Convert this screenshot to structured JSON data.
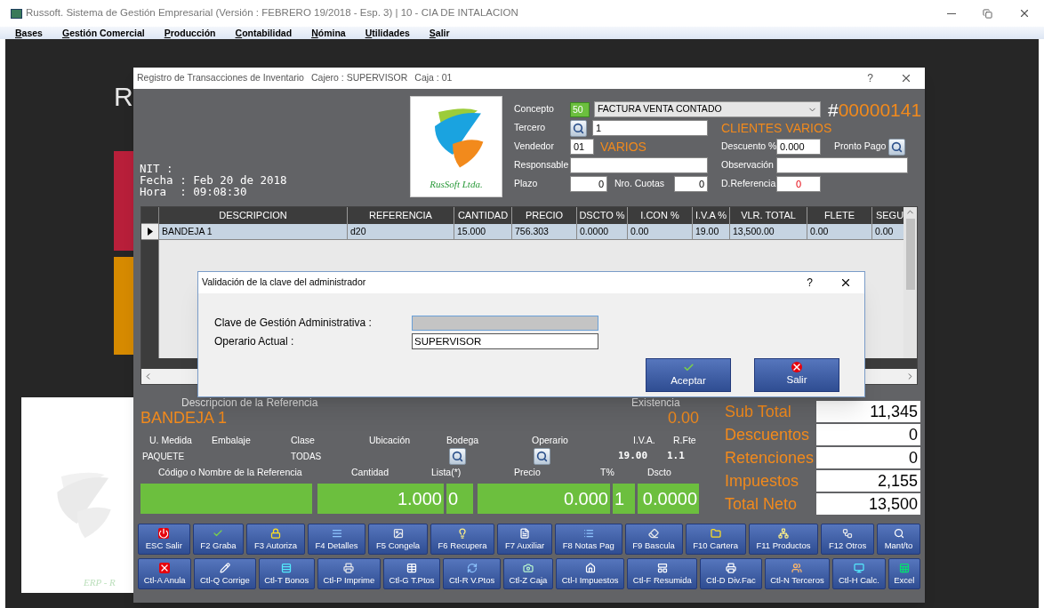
{
  "app_window": {
    "title": "Russoft. Sistema de Gestión Empresarial (Versión : FEBRERO 19/2018 - Esp. 3) | 10 - CIA DE INTALACION"
  },
  "menu": [
    "Bases",
    "Gestión Comercial",
    "Producción",
    "Contabilidad",
    "Nómina",
    "Utilidades",
    "Salir"
  ],
  "background": {
    "letter": "R",
    "footer": "ERP - R"
  },
  "child_window": {
    "title": "Registro de Transacciones de Inventario",
    "cajero": "Cajero : SUPERVISOR",
    "caja": "Caja : 01",
    "help": "?"
  },
  "info": [
    "NIT :",
    "Fecha : Feb 20 de 2018",
    "Hora  : 09:08:30"
  ],
  "logo": {
    "text": "RusSoft Ltda."
  },
  "form": {
    "concepto": {
      "label": "Concepto",
      "code": "50",
      "value": "FACTURA VENTA CONTADO"
    },
    "number": "#00000141",
    "tercero": {
      "label": "Tercero",
      "value": "1",
      "name": "CLIENTES VARIOS"
    },
    "vendedor": {
      "label": "Vendedor",
      "value": "01",
      "name": "VARIOS"
    },
    "descuento": {
      "label": "Descuento %",
      "value": "0.000"
    },
    "pronto_pago": {
      "label": "Pronto Pago"
    },
    "responsable": {
      "label": "Responsable"
    },
    "observacion": {
      "label": "Observación"
    },
    "plazo": {
      "label": "Plazo",
      "value": "0"
    },
    "cuotas": {
      "label": "Nro. Cuotas",
      "value": "0"
    },
    "referencia": {
      "label": "D.Referencia",
      "value": "0"
    }
  },
  "grid": {
    "columns": [
      "DESCRIPCION",
      "REFERENCIA",
      "CANTIDAD",
      "PRECIO",
      "DSCTO %",
      "I.CON %",
      "I.V.A %",
      "VLR. TOTAL",
      "FLETE",
      "SEGU"
    ],
    "rows": [
      {
        "selected": true,
        "cells": [
          "BANDEJA 1",
          "d20",
          "15.000",
          "756.303",
          "0.0000",
          "0.00",
          "19.00",
          "13,500.00",
          "0.00",
          "0.00"
        ]
      }
    ]
  },
  "detail": {
    "desc_label": "Descripcion de la Referencia",
    "existencia_label": "Existencia",
    "description": "BANDEJA 1",
    "existencia": "0.00",
    "labels": [
      "U. Medida",
      "Embalaje",
      "Clase",
      "Ubicación",
      "Bodega",
      "Operario",
      "I.V.A.",
      "R.Fte"
    ],
    "unidad": "PAQUETE",
    "clase": "TODAS",
    "iva": "19.00",
    "rfte": "1.1",
    "entry_labels": [
      "Código o Nombre de la Referencia",
      "Cantidad",
      "Lista(*)",
      "Precio",
      "T%",
      "Dscto"
    ],
    "entry_values": [
      "1.000",
      "0",
      "0.000",
      "1",
      "0.0000"
    ]
  },
  "totals": [
    {
      "label": "Sub Total",
      "value": "11,345"
    },
    {
      "label": "Descuentos",
      "value": "0"
    },
    {
      "label": "Retenciones",
      "value": "0"
    },
    {
      "label": "Impuestos",
      "value": "2,155"
    },
    {
      "label": "Total Neto",
      "value": "13,500"
    }
  ],
  "buttons": [
    [
      "ESC Salir",
      "F2 Graba",
      "F3 Autoriza",
      "F4 Detalles",
      "F5 Congela",
      "F6 Recupera",
      "F7 Auxiliar",
      "F8 Notas Pag",
      "F9 Bascula",
      "F10 Cartera",
      "F11 Productos",
      "F12 Otros",
      "Mant/to"
    ],
    [
      "Ctl-A Anula",
      "Ctl-Q Corrige",
      "Ctl-T Bonos",
      "Ctl-P Imprime",
      "Ctl-G T.Ptos",
      "Ctl-R V.Ptos",
      "Ctl-Z Caja",
      "Ctl-I Impuestos",
      "Ctl-F Resumida",
      "Ctl-D Div.Fac",
      "Ctl-N Terceros",
      "Ctl-H Calc.",
      "Excel"
    ]
  ],
  "dialog": {
    "title": "Validación de la clave del administrador",
    "help": "?",
    "fields": [
      {
        "label": "Clave de Gestión Administrativa :",
        "kind": "password"
      },
      {
        "label": "Operario Actual :",
        "kind": "text",
        "value": "SUPERVISOR"
      }
    ],
    "buttons": [
      {
        "label": "Aceptar",
        "kind": "accept"
      },
      {
        "label": "Salir",
        "kind": "exit"
      }
    ]
  }
}
